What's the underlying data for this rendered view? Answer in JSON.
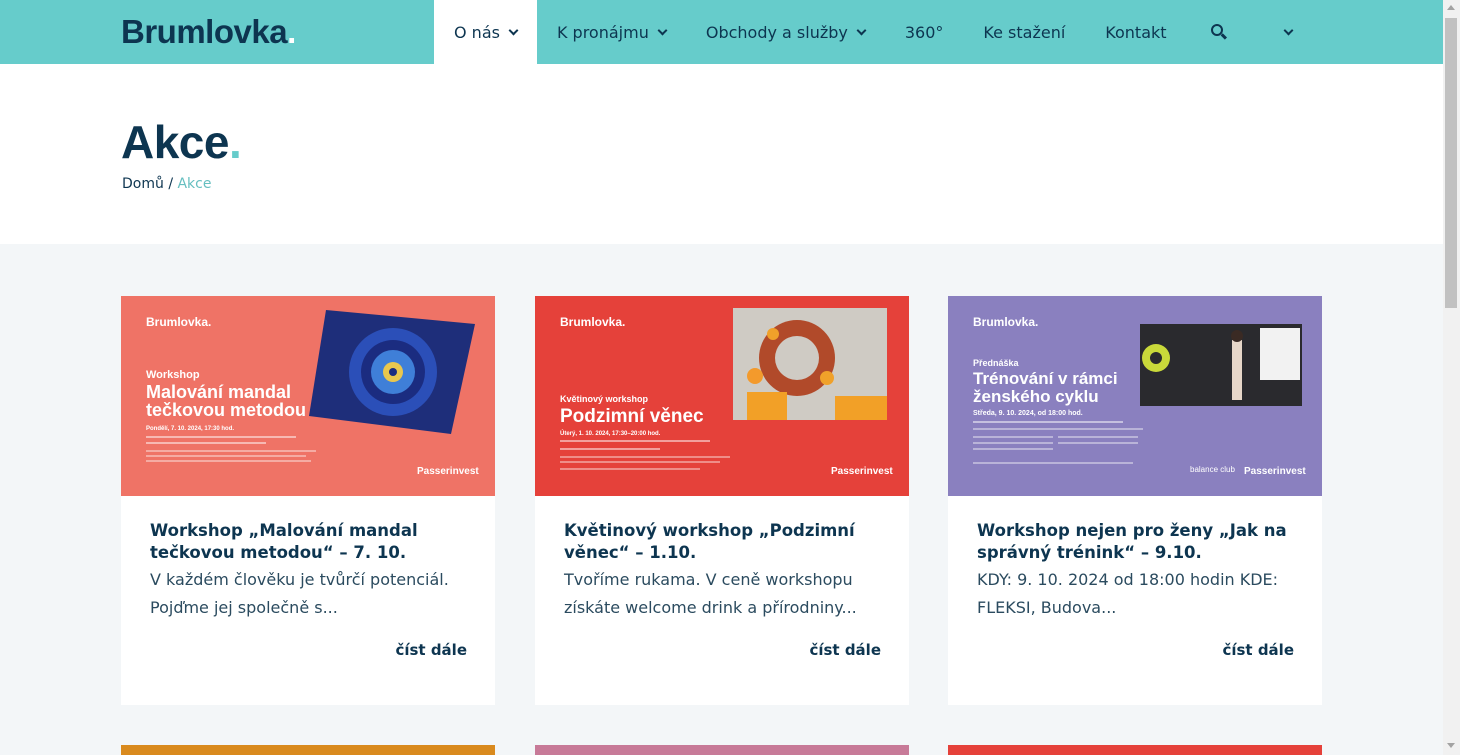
{
  "header": {
    "logo_text": "Brumlovka",
    "logo_dot": ".",
    "nav": [
      {
        "label": "O nás",
        "dropdown": true,
        "active": true
      },
      {
        "label": "K pronájmu",
        "dropdown": true
      },
      {
        "label": "Obchody a služby",
        "dropdown": true
      },
      {
        "label": "360°",
        "dropdown": false
      },
      {
        "label": "Ke stažení",
        "dropdown": false
      },
      {
        "label": "Kontakt",
        "dropdown": false
      }
    ],
    "search_icon": "search-icon",
    "language_icon": "chevron-down-icon"
  },
  "page": {
    "title": "Akce",
    "title_dot": ".",
    "breadcrumb_home": "Domů",
    "breadcrumb_sep": "/",
    "breadcrumb_current": "Akce"
  },
  "colors": {
    "header_bg": "#66cccb",
    "navy": "#0d3550",
    "page_bg": "#f3f6f8"
  },
  "cards": [
    {
      "image": {
        "bg": "#ef7366",
        "brand": "Brumlovka.",
        "kicker": "Workshop",
        "headline_1": "Malování mandal",
        "headline_2": "tečkovou metodou",
        "date": "Pondělí, 7. 10. 2024, 17:30 hod.",
        "sponsor": "Passerinvest"
      },
      "title": "Workshop „Malování mandal tečkovou metodou“ – 7. 10.",
      "excerpt": "V každém člověku je tvůrčí potenciál. Pojďme jej společně s...",
      "more": "číst dále"
    },
    {
      "image": {
        "bg": "#e5413a",
        "brand": "Brumlovka.",
        "kicker": "Květinový workshop",
        "headline_1": "Podzimní věnec",
        "date": "Úterý, 1. 10. 2024, 17:30–20:00 hod.",
        "sponsor": "Passerinvest"
      },
      "title": "Květinový workshop „Podzimní věnec“ – 1.10.",
      "excerpt": "Tvoříme rukama. V ceně workshopu získáte welcome drink a přírodniny...",
      "more": "číst dále"
    },
    {
      "image": {
        "bg": "#8a80bf",
        "brand": "Brumlovka.",
        "kicker": "Přednáška",
        "headline_1": "Trénování v rámci",
        "headline_2": "ženského cyklu",
        "date": "Středa, 9. 10. 2024, od 18:00 hod.",
        "partner": "balance club",
        "sponsor": "Passerinvest"
      },
      "title": "Workshop nejen pro ženy „Jak na správný trénink“ – 9.10.",
      "excerpt": "KDY:  9. 10. 2024 od 18:00 hodin KDE: FLEKSI, Budova...",
      "more": "číst dále"
    }
  ],
  "next_row_colors": [
    "#d98a1e",
    "#c77a98",
    "#e5413a"
  ]
}
